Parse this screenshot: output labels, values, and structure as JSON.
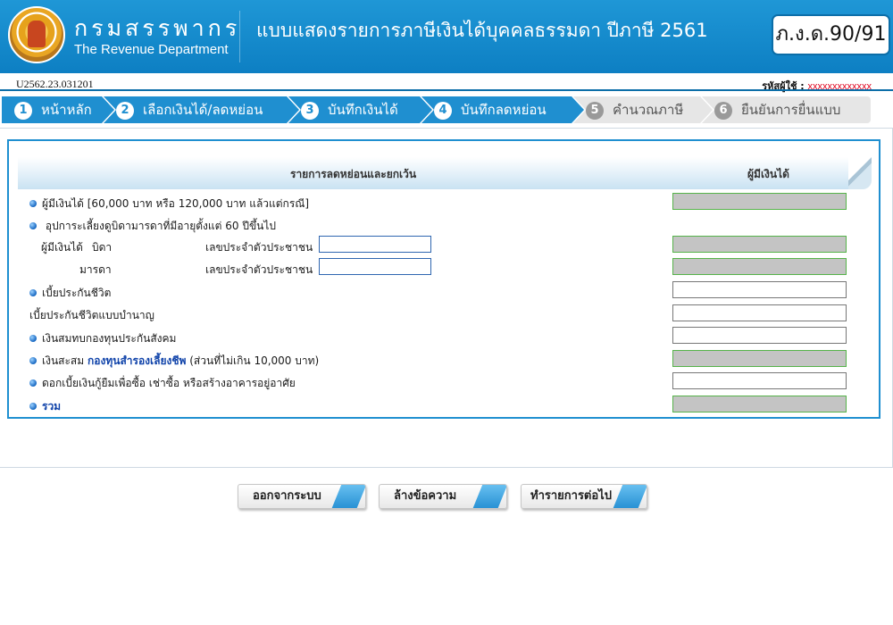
{
  "header": {
    "brand_thai": "กรมสรรพากร",
    "brand_eng": "The Revenue Department",
    "form_title": "แบบแสดงรายการภาษีเงินได้บุคคลธรรมดา ปีภาษี 2561",
    "form_code": "ภ.ง.ด.90/91"
  },
  "ref_code": "U2562.23.031201",
  "user": {
    "label": "รหัสผู้ใช้ :",
    "id": "xxxxxxxxxxxxx"
  },
  "steps": [
    {
      "num": "1",
      "label": "หน้าหลัก",
      "state": "active"
    },
    {
      "num": "2",
      "label": "เลือกเงินได้/ลดหย่อน",
      "state": "active"
    },
    {
      "num": "3",
      "label": "บันทึกเงินได้",
      "state": "active"
    },
    {
      "num": "4",
      "label": "บันทึกลดหย่อน",
      "state": "active"
    },
    {
      "num": "5",
      "label": "คำนวณภาษี",
      "state": "inactive"
    },
    {
      "num": "6",
      "label": "ยืนยันการยื่นแบบ",
      "state": "inactive"
    }
  ],
  "table": {
    "col_items": "รายการลดหย่อนและยกเว้น",
    "col_payer": "ผู้มีเงินได้",
    "rows": {
      "personal": "ผู้มีเงินได้ [60,000 บาท หรือ 120,000 บาท แล้วแต่กรณี]",
      "parents": "อุปการะเลี้ยงดูบิดามารดาที่มีอายุตั้งแต่ 60 ปีขึ้นไป",
      "payer_prefix": "ผู้มีเงินได้",
      "father": "บิดา",
      "mother": "มารดา",
      "id_label": "เลขประจำตัวประชาชน",
      "life_insurance": "เบี้ยประกันชีวิต",
      "pension_insurance": "เบี้ยประกันชีวิตแบบบำนาญ",
      "social_security": "เงินสมทบกองทุนประกันสังคม",
      "provident_prefix": "เงินสะสม",
      "provident_fund": "กองทุนสำรองเลี้ยงชีพ",
      "provident_suffix": "(ส่วนที่ไม่เกิน 10,000 บาท)",
      "housing_interest": "ดอกเบี้ยเงินกู้ยืมเพื่อซื้อ เช่าซื้อ หรือสร้างอาคารอยู่อาศัย",
      "total": "รวม"
    }
  },
  "buttons": {
    "logout": "ออกจากระบบ",
    "clear": "ล้างข้อความ",
    "next": "ทำรายการต่อไป"
  },
  "colors": {
    "header_blue": "#1f97d6",
    "step_active": "#1f8fd0",
    "step_inactive": "#e6e6e6",
    "readonly_field": "#c4c4c4",
    "readonly_border": "#56b34a",
    "user_id": "#e0001b"
  }
}
